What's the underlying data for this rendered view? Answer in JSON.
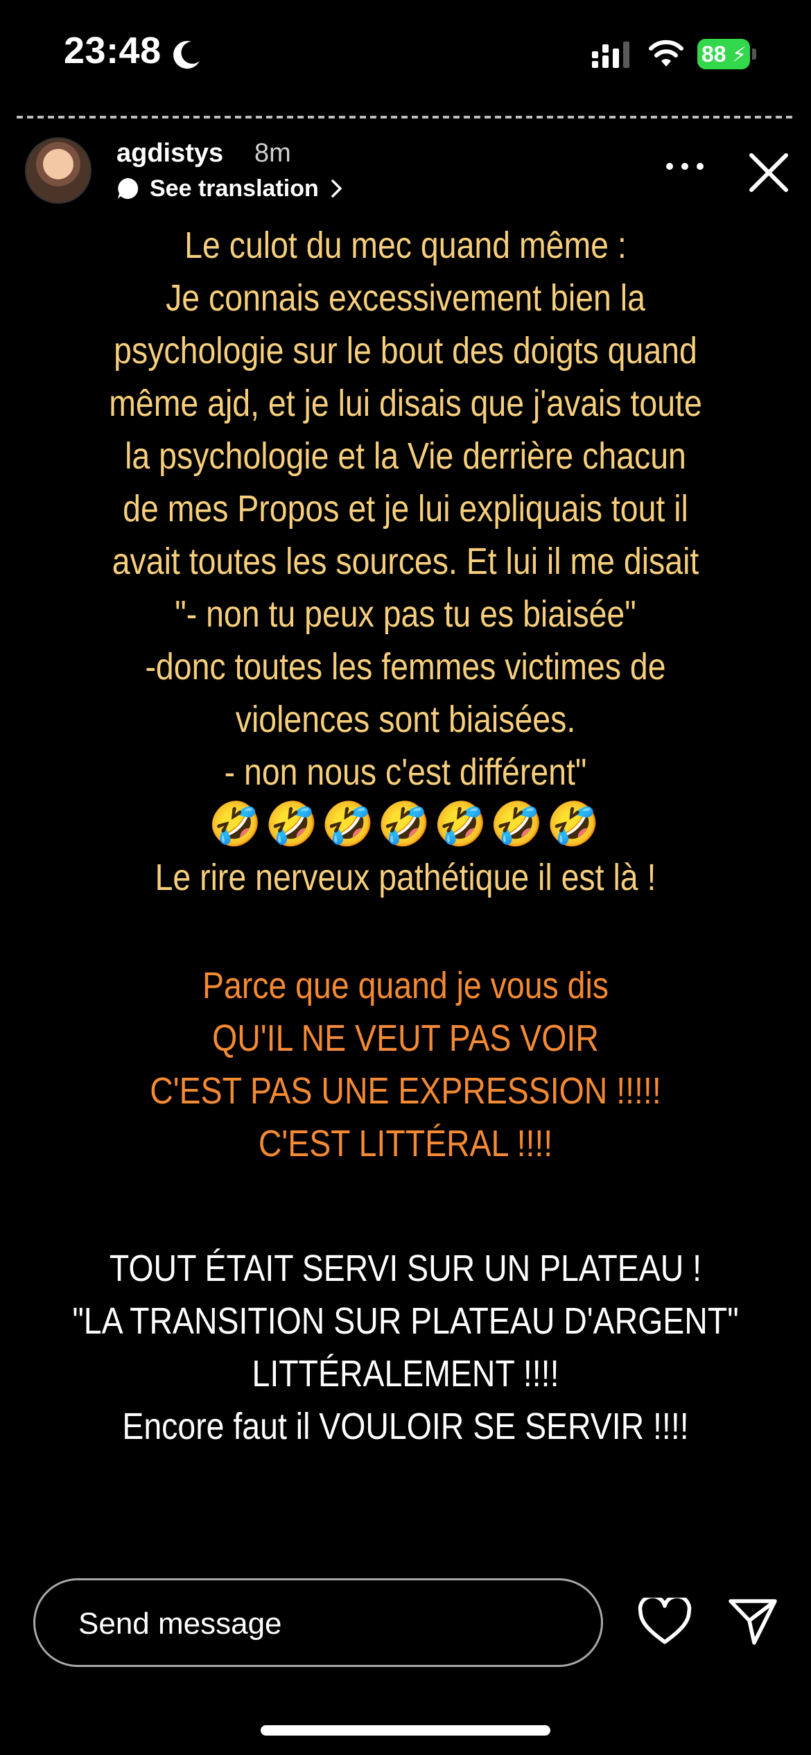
{
  "status_bar": {
    "time": "23:48",
    "battery": "88"
  },
  "story": {
    "username": "agdistys",
    "time_ago": "8m",
    "translate_label": "See translation",
    "block_1": {
      "lines": [
        "Le culot du mec quand même :",
        "Je connais excessivement bien la",
        "psychologie sur le bout des doigts quand",
        "même ajd, et je lui disais que j'avais toute",
        "la psychologie et la Vie derrière chacun",
        "de mes Propos et je lui expliquais tout il",
        "avait toutes les sources. Et lui il me disait",
        "\"- non tu peux pas tu es biaisée\"",
        "-donc toutes les femmes victimes de",
        "violences sont biaisées.",
        "- non nous c'est différent\""
      ],
      "emojis": "🤣🤣🤣🤣🤣🤣🤣",
      "after_emojis": "Le rire nerveux pathétique il est là !"
    },
    "block_2": {
      "lines": [
        "Parce que quand je vous dis",
        "QU'IL NE VEUT PAS VOIR",
        "C'EST PAS UNE EXPRESSION !!!!!",
        "C'EST LITTÉRAL !!!!"
      ]
    },
    "block_3": {
      "lines": [
        "TOUT ÉTAIT SERVI SUR UN PLATEAU !",
        "\"LA TRANSITION SUR PLATEAU D'ARGENT\"",
        "LITTÉRALEMENT !!!!",
        "Encore faut il VOULOIR SE SERVIR !!!!"
      ]
    }
  },
  "bottom_bar": {
    "message_placeholder": "Send message"
  },
  "colors": {
    "yellow_text": "#f7cf7c",
    "orange_text": "#f48a33",
    "white_text": "#ffffff",
    "battery_green": "#32d74b"
  },
  "icons": [
    "moon-icon",
    "signal-icon",
    "wifi-icon",
    "battery-icon",
    "translate-icon",
    "chevron-right-icon",
    "more-icon",
    "close-icon",
    "heart-icon",
    "send-icon"
  ]
}
